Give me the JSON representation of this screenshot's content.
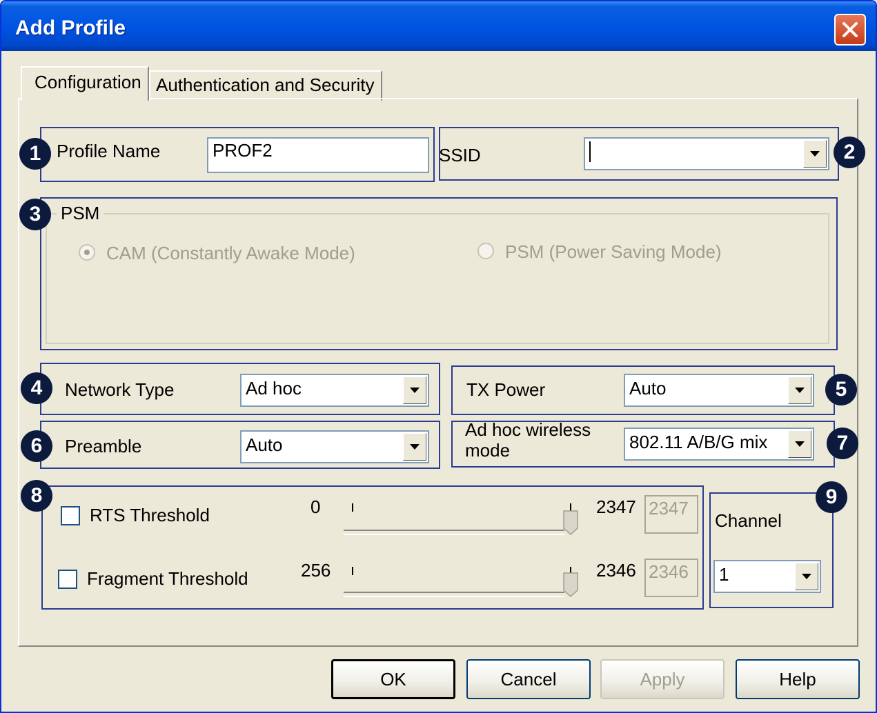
{
  "window": {
    "title": "Add Profile"
  },
  "tabs": [
    {
      "label": "Configuration"
    },
    {
      "label": "Authentication and Security"
    }
  ],
  "badges": [
    "1",
    "2",
    "3",
    "4",
    "5",
    "6",
    "7",
    "8",
    "9"
  ],
  "profile": {
    "label": "Profile Name",
    "value": "PROF2"
  },
  "ssid": {
    "label": "SSID",
    "value": ""
  },
  "psm": {
    "title": "PSM",
    "options": [
      {
        "label": "CAM (Constantly Awake Mode)",
        "checked": true
      },
      {
        "label": "PSM (Power Saving Mode)",
        "checked": false
      }
    ]
  },
  "network_type": {
    "label": "Network Type",
    "value": "Ad hoc"
  },
  "tx_power": {
    "label": "TX Power",
    "value": "Auto"
  },
  "preamble": {
    "label": "Preamble",
    "value": "Auto"
  },
  "adhoc_mode": {
    "label_line1": "Ad hoc wireless",
    "label_line2": "mode",
    "value": "802.11 A/B/G mix"
  },
  "rts": {
    "label": "RTS Threshold",
    "min": "0",
    "max": "2347",
    "value": "2347"
  },
  "fragment": {
    "label": "Fragment Threshold",
    "min": "256",
    "max": "2346",
    "value": "2346"
  },
  "channel": {
    "label": "Channel",
    "value": "1"
  },
  "buttons": {
    "ok": "OK",
    "cancel": "Cancel",
    "apply": "Apply",
    "help": "Help"
  },
  "icons": {
    "close": "close-icon",
    "dropdown": "chevron-down-icon"
  }
}
